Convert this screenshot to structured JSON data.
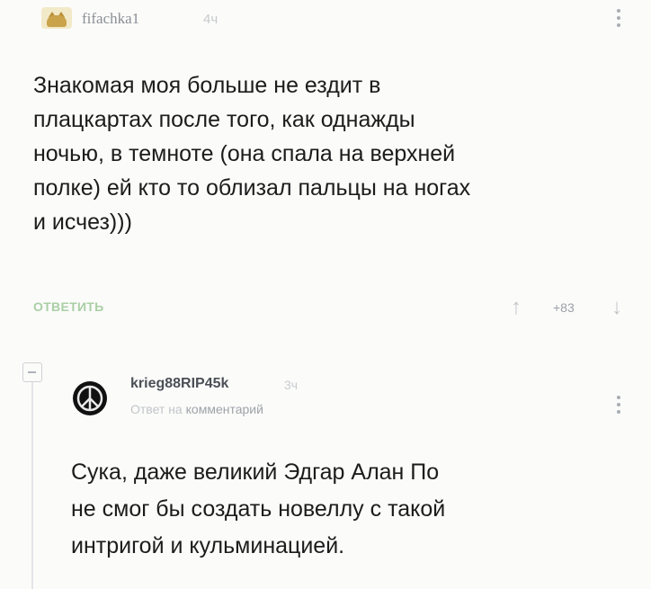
{
  "comment": {
    "username": "fifachka1",
    "time": "4ч",
    "text": "Знакомая моя больше не ездит в\nплацкартах после того, как однажды\nночью, в темноте (она спала на верхней\nполке) ей кто то облизал пальцы на ногах\nи исчез)))",
    "reply_label": "ОТВЕТИТЬ",
    "rating": "+83",
    "avatar_icon": "cat-avatar-icon"
  },
  "reply": {
    "username": "krieg88RIP45k",
    "time": "3ч",
    "reply_to_prefix": "Ответ на",
    "reply_to_link": "комментарий",
    "text": "Сука, даже великий Эдгар Алан По\nне смог бы создать новеллу с такой\nинтригой и кульминацией.",
    "avatar_icon": "peace-sign-avatar-icon"
  },
  "colors": {
    "background": "#fbfbfa",
    "reply_button": "#a9cfa4",
    "meta_text": "#a8adb2"
  }
}
